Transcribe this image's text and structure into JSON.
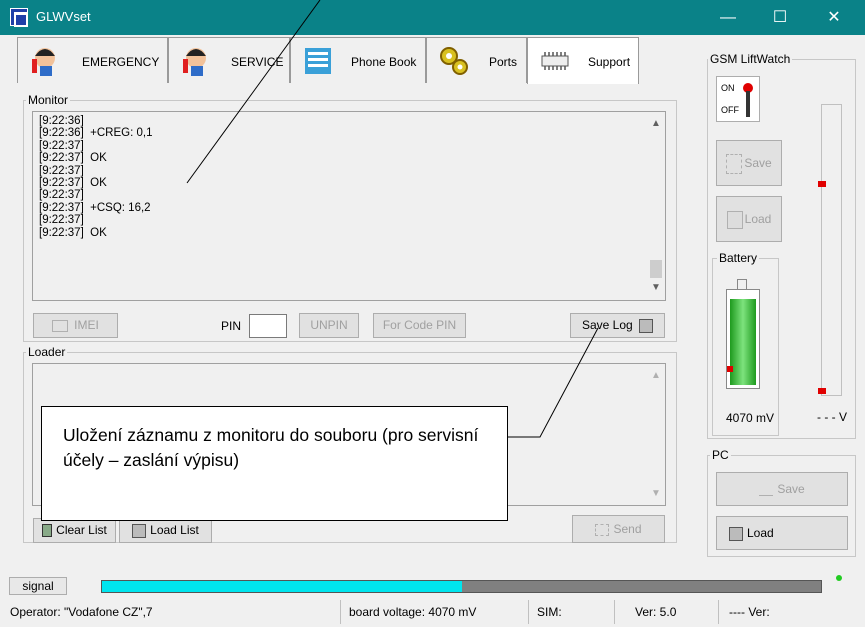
{
  "window": {
    "title": "GLWVset",
    "buttons": [
      "—",
      "☐",
      "✕"
    ]
  },
  "tabs": [
    {
      "label": "EMERGENCY",
      "icon": "operator-headset-icon"
    },
    {
      "label": "SERVICE",
      "icon": "operator-headset-icon"
    },
    {
      "label": "Phone Book",
      "icon": "phone-book-icon"
    },
    {
      "label": "Ports",
      "icon": "gears-icon"
    },
    {
      "label": "Support",
      "icon": "chip-icon",
      "active": true
    }
  ],
  "monitor": {
    "label": "Monitor",
    "log": [
      "[9:22:36]",
      "[9:22:36]  +CREG: 0,1",
      "[9:22:37]",
      "[9:22:37]  OK",
      "[9:22:37]",
      "[9:22:37]  OK",
      "[9:22:37]",
      "[9:22:37]  +CSQ: 16,2",
      "[9:22:37]",
      "[9:22:37]  OK"
    ],
    "imei_label": "IMEI",
    "pin_label": "PIN",
    "pin_value": "",
    "unpin_label": "UNPIN",
    "for_code_pin_label": "For Code PIN",
    "save_log_label": "Save Log"
  },
  "loader": {
    "label": "Loader",
    "clear_list_label": "Clear List",
    "load_list_label": "Load List",
    "send_label": "Send"
  },
  "gsm": {
    "label": "GSM LiftWatch",
    "switch_on": "ON",
    "switch_off": "OFF",
    "save_label": "Save",
    "load_label": "Load",
    "battery_label": "Battery",
    "battery_value": "4070 mV",
    "level_value": "- - - V",
    "battery_fill": 0.92
  },
  "pc": {
    "label": "PC",
    "save_label": "Save",
    "load_label": "Load"
  },
  "signal": {
    "label": "signal",
    "fill": 0.5
  },
  "statusbar": {
    "operator": "Operator: \"Vodafone CZ\",7",
    "voltage": "board voltage: 4070 mV",
    "sim": "SIM:",
    "ver": "Ver: 5.0",
    "ver2": "---- Ver:"
  },
  "callout": {
    "text": "Uložení záznamu z monitoru do souboru (pro servisní účely – zaslání výpisu)"
  },
  "colors": {
    "titlebar": "#0a8288",
    "signal": "#00e5ee",
    "battery": "#3cbf3c",
    "marker": "#e00000",
    "led": "#22cc22"
  }
}
